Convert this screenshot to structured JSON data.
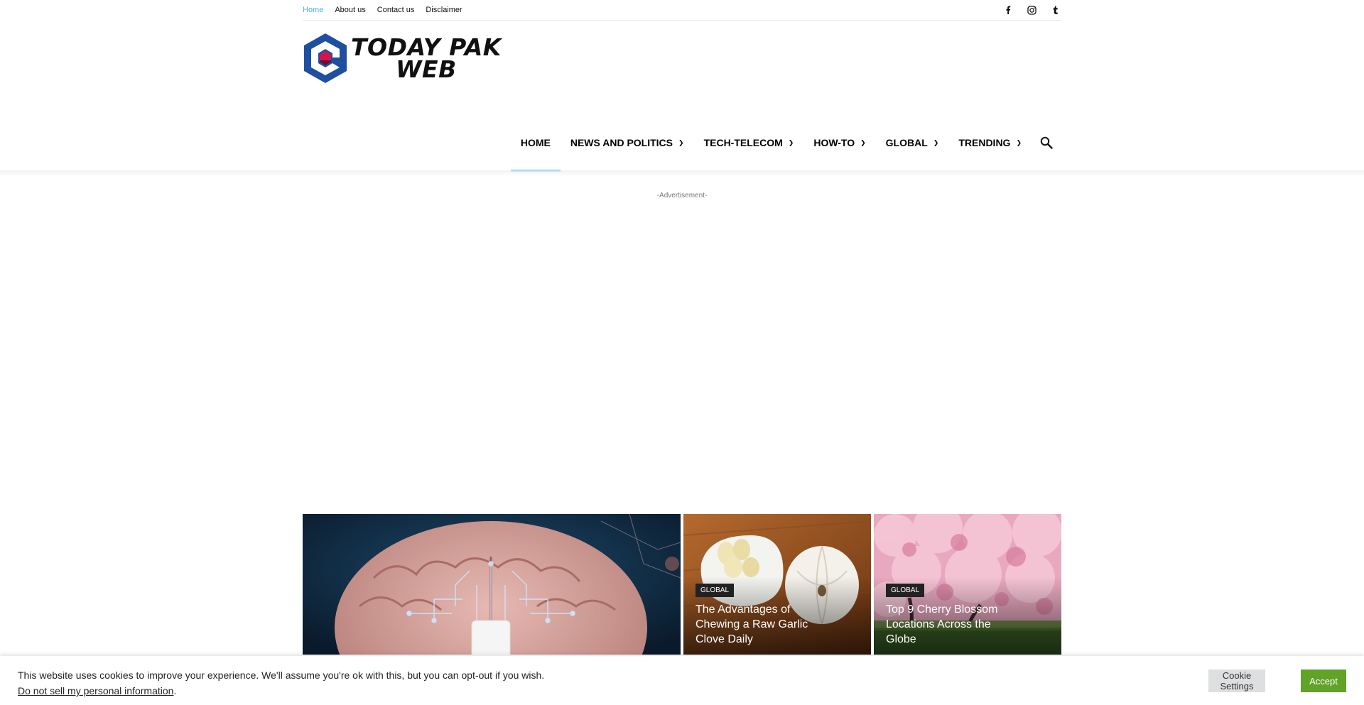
{
  "top_menu": [
    {
      "label": "Home"
    },
    {
      "label": "About us"
    },
    {
      "label": "Contact us"
    },
    {
      "label": "Disclaimer"
    }
  ],
  "social_icons": [
    "facebook-icon",
    "instagram-icon",
    "tumblr-icon"
  ],
  "logo": {
    "line1": "TODAY PAK",
    "line2": "WEB"
  },
  "nav": {
    "items": [
      {
        "label": "HOME"
      },
      {
        "label": "NEWS AND POLITICS"
      },
      {
        "label": "TECH-TELECOM"
      },
      {
        "label": "HOW-TO"
      },
      {
        "label": "GLOBAL"
      },
      {
        "label": "TRENDING"
      }
    ],
    "active_color": "#4db2ec"
  },
  "ad_label": "-Advertisement-",
  "featured": [
    {
      "category": "GLOBAL",
      "title": "The Advantages of Chewing a Raw Garlic Clove Daily"
    },
    {
      "category": "GLOBAL",
      "title": "Top 9 Cherry Blossom Locations Across the Globe"
    }
  ],
  "cookie": {
    "message": "This website uses cookies to improve your experience. We'll assume you're ok with this, but you can opt-out if you wish.",
    "link": "Do not sell my personal information",
    "link_suffix": ".",
    "settings_label": "Cookie Settings",
    "accept_label": "Accept",
    "accept_color": "#61a229"
  }
}
